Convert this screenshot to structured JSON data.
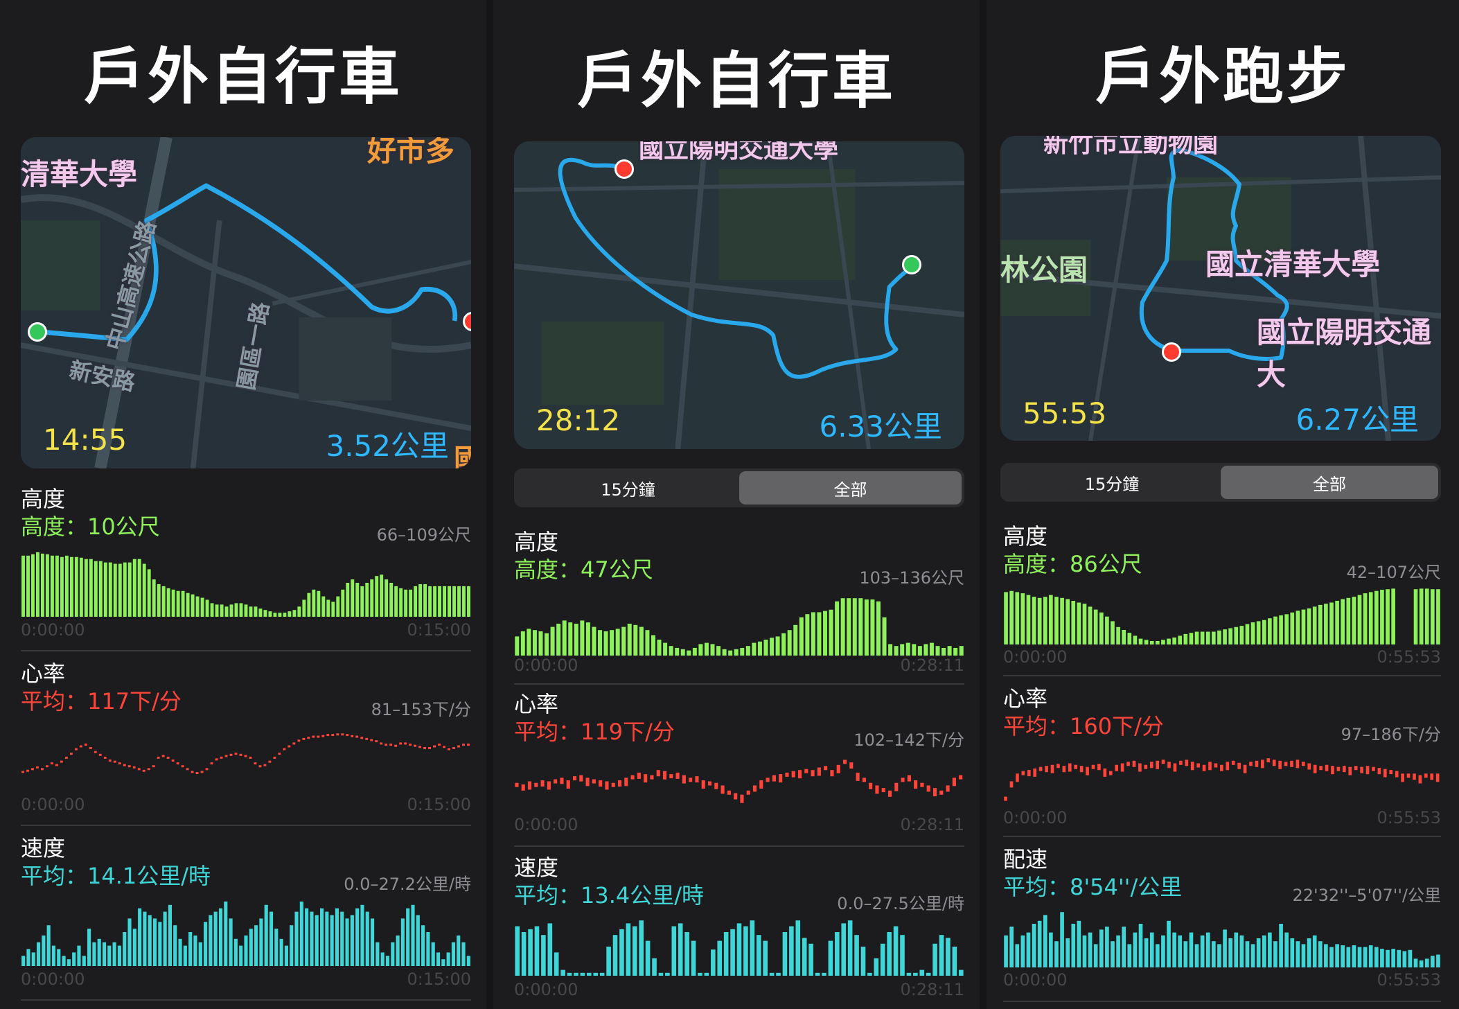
{
  "columns": [
    {
      "title": "戶外自行車",
      "map": {
        "time": "14:55",
        "distance": "3.52公里",
        "labels": [
          "清華大學",
          "好市多",
          "新安路",
          "中山高速公路",
          "園區一路",
          "國道"
        ]
      },
      "segmented": null,
      "metrics": [
        {
          "title": "高度",
          "summary": "高度：10公尺",
          "range": "66–109公尺",
          "color": "#8ef05a",
          "start": "0:00:00",
          "end": "0:15:00",
          "kind": "bars",
          "values": [
            0.9,
            0.9,
            0.92,
            0.95,
            0.93,
            0.92,
            0.9,
            0.9,
            0.88,
            0.9,
            0.88,
            0.88,
            0.87,
            0.85,
            0.85,
            0.82,
            0.82,
            0.8,
            0.8,
            0.78,
            0.78,
            0.8,
            0.8,
            0.85,
            0.85,
            0.78,
            0.7,
            0.55,
            0.48,
            0.45,
            0.42,
            0.4,
            0.38,
            0.38,
            0.35,
            0.33,
            0.3,
            0.28,
            0.25,
            0.2,
            0.18,
            0.18,
            0.15,
            0.18,
            0.2,
            0.2,
            0.18,
            0.15,
            0.15,
            0.12,
            0.1,
            0.08,
            0.06,
            0.06,
            0.06,
            0.08,
            0.1,
            0.15,
            0.25,
            0.35,
            0.4,
            0.38,
            0.3,
            0.25,
            0.22,
            0.3,
            0.4,
            0.5,
            0.55,
            0.5,
            0.45,
            0.5,
            0.55,
            0.6,
            0.62,
            0.55,
            0.5,
            0.45,
            0.42,
            0.4,
            0.4,
            0.45,
            0.48,
            0.48,
            0.45,
            0.45,
            0.45,
            0.45,
            0.45,
            0.45,
            0.45,
            0.45,
            0.45
          ]
        },
        {
          "title": "心率",
          "summary": "平均：117下/分",
          "range": "81–153下/分",
          "color": "#ff453a",
          "start": "0:00:00",
          "end": "0:15:00",
          "kind": "dots",
          "values": [
            0.3,
            0.32,
            0.35,
            0.38,
            0.35,
            0.4,
            0.45,
            0.42,
            0.48,
            0.55,
            0.62,
            0.7,
            0.75,
            0.78,
            0.72,
            0.65,
            0.6,
            0.55,
            0.5,
            0.48,
            0.45,
            0.42,
            0.4,
            0.38,
            0.35,
            0.32,
            0.35,
            0.4,
            0.55,
            0.58,
            0.55,
            0.5,
            0.45,
            0.4,
            0.35,
            0.3,
            0.28,
            0.3,
            0.35,
            0.45,
            0.52,
            0.55,
            0.58,
            0.6,
            0.62,
            0.6,
            0.58,
            0.55,
            0.45,
            0.4,
            0.42,
            0.48,
            0.55,
            0.62,
            0.7,
            0.75,
            0.8,
            0.85,
            0.88,
            0.9,
            0.92,
            0.92,
            0.93,
            0.95,
            0.95,
            0.96,
            0.96,
            0.95,
            0.93,
            0.92,
            0.9,
            0.88,
            0.86,
            0.84,
            0.8,
            0.78,
            0.78,
            0.76,
            0.8,
            0.8,
            0.78,
            0.76,
            0.74,
            0.72,
            0.72,
            0.75,
            0.78,
            0.74,
            0.7,
            0.72,
            0.75,
            0.78,
            0.78
          ]
        },
        {
          "title": "速度",
          "summary": "平均：14.1公里/時",
          "range": "0.0–27.2公里/時",
          "color": "#3fd6d8",
          "start": "0:00:00",
          "end": "0:15:00",
          "kind": "bars",
          "values": [
            0.15,
            0.25,
            0.2,
            0.35,
            0.45,
            0.6,
            0.3,
            0.25,
            0.15,
            0.1,
            0.2,
            0.3,
            0.15,
            0.55,
            0.35,
            0.4,
            0.35,
            0.3,
            0.35,
            0.3,
            0.5,
            0.7,
            0.55,
            0.85,
            0.8,
            0.75,
            0.7,
            0.65,
            0.8,
            0.9,
            0.6,
            0.4,
            0.3,
            0.5,
            0.45,
            0.35,
            0.65,
            0.75,
            0.8,
            0.85,
            0.95,
            0.7,
            0.4,
            0.3,
            0.45,
            0.55,
            0.6,
            0.7,
            0.9,
            0.8,
            0.55,
            0.4,
            0.3,
            0.6,
            0.8,
            0.95,
            0.85,
            0.8,
            0.75,
            0.85,
            0.8,
            0.75,
            0.85,
            0.8,
            0.7,
            0.75,
            0.85,
            0.9,
            0.8,
            0.7,
            0.35,
            0.2,
            0.15,
            0.35,
            0.45,
            0.7,
            0.85,
            0.9,
            0.75,
            0.6,
            0.5,
            0.35,
            0.2,
            0.1,
            0.2,
            0.35,
            0.45,
            0.35,
            0.15
          ]
        }
      ]
    },
    {
      "title": "戶外自行車",
      "map": {
        "time": "28:12",
        "distance": "6.33公里",
        "labels": [
          "國立陽明交通大學"
        ]
      },
      "segmented": {
        "options": [
          "15分鐘",
          "全部"
        ],
        "selected": 1
      },
      "metrics": [
        {
          "title": "高度",
          "summary": "高度：47公尺",
          "range": "103–136公尺",
          "color": "#8ef05a",
          "start": "0:00:00",
          "end": "0:28:11",
          "kind": "bars",
          "values": [
            0.3,
            0.38,
            0.42,
            0.4,
            0.38,
            0.35,
            0.45,
            0.5,
            0.55,
            0.52,
            0.5,
            0.55,
            0.52,
            0.45,
            0.4,
            0.38,
            0.4,
            0.42,
            0.45,
            0.5,
            0.48,
            0.45,
            0.4,
            0.32,
            0.25,
            0.2,
            0.15,
            0.12,
            0.1,
            0.08,
            0.12,
            0.18,
            0.2,
            0.18,
            0.15,
            0.1,
            0.08,
            0.1,
            0.12,
            0.15,
            0.2,
            0.22,
            0.25,
            0.28,
            0.3,
            0.35,
            0.4,
            0.48,
            0.6,
            0.65,
            0.68,
            0.68,
            0.7,
            0.72,
            0.85,
            0.9,
            0.9,
            0.9,
            0.9,
            0.88,
            0.88,
            0.85,
            0.6,
            0.18,
            0.15,
            0.18,
            0.2,
            0.18,
            0.15,
            0.18,
            0.2,
            0.15,
            0.12,
            0.15,
            0.12,
            0.15
          ]
        },
        {
          "title": "心率",
          "summary": "平均：119下/分",
          "range": "102–142下/分",
          "color": "#ff453a",
          "start": "0:00:00",
          "end": "0:28:11",
          "kind": "bars-thin",
          "values": [
            0.45,
            0.42,
            0.48,
            0.45,
            0.5,
            0.48,
            0.52,
            0.55,
            0.5,
            0.58,
            0.6,
            0.55,
            0.52,
            0.5,
            0.48,
            0.45,
            0.5,
            0.55,
            0.6,
            0.65,
            0.62,
            0.6,
            0.7,
            0.68,
            0.62,
            0.65,
            0.6,
            0.55,
            0.58,
            0.5,
            0.48,
            0.45,
            0.4,
            0.3,
            0.25,
            0.22,
            0.3,
            0.4,
            0.5,
            0.55,
            0.6,
            0.62,
            0.65,
            0.68,
            0.7,
            0.72,
            0.7,
            0.75,
            0.78,
            0.7,
            0.8,
            0.9,
            0.85,
            0.65,
            0.55,
            0.45,
            0.4,
            0.35,
            0.3,
            0.45,
            0.55,
            0.6,
            0.5,
            0.45,
            0.4,
            0.35,
            0.3,
            0.4,
            0.55,
            0.6
          ]
        },
        {
          "title": "速度",
          "summary": "平均：13.4公里/時",
          "range": "0.0–27.5公里/時",
          "color": "#3fd6d8",
          "start": "0:00:00",
          "end": "0:28:11",
          "kind": "bars",
          "values": [
            0.85,
            0.75,
            0.8,
            0.85,
            0.7,
            0.9,
            0.4,
            0.1,
            0.05,
            0.05,
            0.05,
            0.05,
            0.05,
            0.05,
            0.5,
            0.7,
            0.8,
            0.9,
            0.85,
            0.95,
            0.6,
            0.3,
            0.05,
            0.05,
            0.85,
            0.9,
            0.75,
            0.6,
            0.05,
            0.05,
            0.45,
            0.6,
            0.75,
            0.8,
            0.9,
            0.85,
            0.95,
            0.7,
            0.6,
            0.05,
            0.05,
            0.75,
            0.85,
            0.95,
            0.65,
            0.55,
            0.05,
            0.05,
            0.6,
            0.75,
            0.9,
            0.95,
            0.7,
            0.5,
            0.05,
            0.3,
            0.55,
            0.75,
            0.85,
            0.7,
            0.05,
            0.05,
            0.1,
            0.05,
            0.55,
            0.7,
            0.65,
            0.5,
            0.1
          ]
        }
      ]
    },
    {
      "title": "戶外跑步",
      "map": {
        "time": "55:53",
        "distance": "6.27公里",
        "labels": [
          "新竹市立動物園",
          "林公園",
          "國立清華大學",
          "國立陽明交通大"
        ]
      },
      "segmented": {
        "options": [
          "15分鐘",
          "全部"
        ],
        "selected": 1
      },
      "metrics": [
        {
          "title": "高度",
          "summary": "高度：86公尺",
          "range": "42–107公尺",
          "color": "#8ef05a",
          "start": "0:00:00",
          "end": "0:55:53",
          "kind": "bars",
          "values": [
            0.9,
            0.92,
            0.9,
            0.88,
            0.85,
            0.82,
            0.8,
            0.82,
            0.85,
            0.82,
            0.8,
            0.78,
            0.75,
            0.72,
            0.7,
            0.65,
            0.6,
            0.55,
            0.48,
            0.4,
            0.3,
            0.25,
            0.2,
            0.15,
            0.1,
            0.08,
            0.06,
            0.06,
            0.08,
            0.1,
            0.12,
            0.15,
            0.18,
            0.2,
            0.22,
            0.22,
            0.22,
            0.22,
            0.24,
            0.26,
            0.28,
            0.3,
            0.32,
            0.35,
            0.38,
            0.4,
            0.42,
            0.45,
            0.48,
            0.5,
            0.52,
            0.55,
            0.58,
            0.6,
            0.62,
            0.65,
            0.68,
            0.7,
            0.72,
            0.75,
            0.78,
            0.8,
            0.82,
            0.85,
            0.88,
            0.9,
            0.92,
            0.94,
            0.95,
            0.96,
            0.0,
            0.0,
            0.0,
            0.95,
            0.96,
            0.96,
            0.95,
            0.95
          ]
        },
        {
          "title": "心率",
          "summary": "平均：160下/分",
          "range": "97–186下/分",
          "color": "#ff453a",
          "start": "0:00:00",
          "end": "0:55:53",
          "kind": "bars-thin",
          "values": [
            0.1,
            0.4,
            0.55,
            0.6,
            0.62,
            0.65,
            0.68,
            0.7,
            0.72,
            0.74,
            0.7,
            0.75,
            0.72,
            0.7,
            0.68,
            0.72,
            0.74,
            0.65,
            0.6,
            0.72,
            0.75,
            0.78,
            0.8,
            0.75,
            0.72,
            0.78,
            0.8,
            0.82,
            0.78,
            0.75,
            0.8,
            0.82,
            0.78,
            0.75,
            0.72,
            0.78,
            0.75,
            0.72,
            0.78,
            0.8,
            0.76,
            0.72,
            0.78,
            0.8,
            0.82,
            0.85,
            0.82,
            0.8,
            0.78,
            0.8,
            0.82,
            0.78,
            0.75,
            0.72,
            0.7,
            0.72,
            0.7,
            0.68,
            0.7,
            0.68,
            0.7,
            0.68,
            0.7,
            0.68,
            0.66,
            0.64,
            0.62,
            0.6,
            0.55,
            0.55,
            0.55,
            0.52,
            0.55,
            0.55,
            0.55
          ]
        },
        {
          "title": "配速",
          "summary": "平均：8'54''/公里",
          "range": "22'32''–5'07''/公里",
          "color": "#3fd6d8",
          "start": "0:00:00",
          "end": "0:55:53",
          "kind": "bars",
          "values": [
            0.55,
            0.7,
            0.4,
            0.55,
            0.6,
            0.75,
            0.8,
            0.9,
            0.6,
            0.45,
            0.95,
            0.5,
            0.75,
            0.8,
            0.55,
            0.6,
            0.4,
            0.65,
            0.7,
            0.45,
            0.55,
            0.7,
            0.4,
            0.6,
            0.75,
            0.5,
            0.6,
            0.4,
            0.55,
            0.8,
            0.6,
            0.55,
            0.45,
            0.6,
            0.4,
            0.55,
            0.6,
            0.45,
            0.4,
            0.65,
            0.5,
            0.6,
            0.55,
            0.45,
            0.4,
            0.5,
            0.55,
            0.6,
            0.45,
            0.75,
            0.6,
            0.5,
            0.45,
            0.4,
            0.5,
            0.55,
            0.45,
            0.4,
            0.35,
            0.4,
            0.38,
            0.35,
            0.38,
            0.35,
            0.35,
            0.38,
            0.35,
            0.32,
            0.3,
            0.32,
            0.3,
            0.28,
            0.3,
            0.15,
            0.12,
            0.15,
            0.2,
            0.22
          ]
        }
      ]
    }
  ]
}
